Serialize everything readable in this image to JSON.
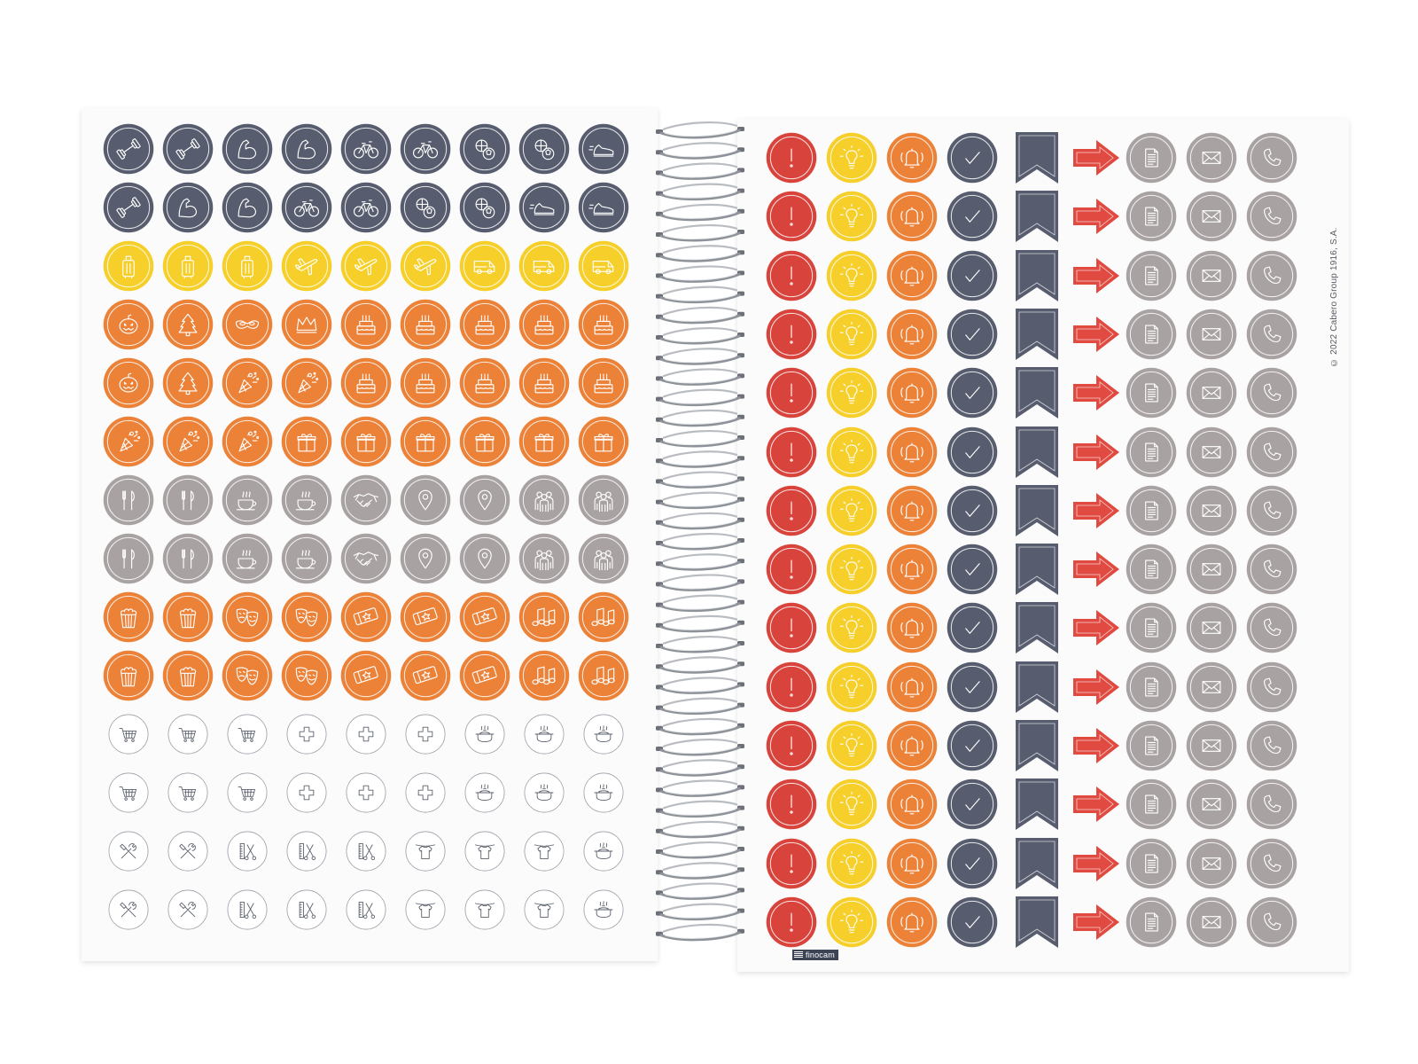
{
  "colors": {
    "slate": "#575d6e",
    "yellow": "#f6cf2b",
    "orange": "#ec8138",
    "gray": "#a9a2a2",
    "red": "#d8433c",
    "arrow_red": "#e04a40",
    "outline": "#8b9099",
    "page": "#fbfbfb",
    "wire": "#8e939a"
  },
  "left_sheet": {
    "rows": [
      {
        "color": "slate",
        "icons": [
          "dumbbell-icon",
          "dumbbell-icon",
          "flexed-arm-icon",
          "flexed-arm-icon",
          "bicycle-icon",
          "bicycle-icon",
          "sports-balls-icon",
          "sports-balls-icon",
          "sneaker-icon"
        ]
      },
      {
        "color": "slate",
        "icons": [
          "dumbbell-icon",
          "flexed-arm-icon",
          "flexed-arm-icon",
          "bicycle-icon",
          "bicycle-icon",
          "sports-balls-icon",
          "sports-balls-icon",
          "sneaker-icon",
          "sneaker-icon"
        ]
      },
      {
        "color": "yellow",
        "icons": [
          "suitcase-icon",
          "suitcase-icon",
          "suitcase-icon",
          "airplane-icon",
          "airplane-icon",
          "airplane-icon",
          "van-icon",
          "van-icon",
          "van-icon"
        ]
      },
      {
        "color": "orange",
        "icons": [
          "pumpkin-icon",
          "christmas-tree-icon",
          "carnival-mask-icon",
          "crown-icon",
          "birthday-cake-icon",
          "birthday-cake-icon",
          "birthday-cake-icon",
          "birthday-cake-icon",
          "birthday-cake-icon"
        ]
      },
      {
        "color": "orange",
        "icons": [
          "pumpkin-icon",
          "christmas-tree-icon",
          "party-popper-icon",
          "party-popper-icon",
          "birthday-cake-icon",
          "birthday-cake-icon",
          "birthday-cake-icon",
          "birthday-cake-icon",
          "birthday-cake-icon"
        ]
      },
      {
        "color": "orange",
        "icons": [
          "party-popper-icon",
          "party-popper-icon",
          "party-popper-icon",
          "gift-icon",
          "gift-icon",
          "gift-icon",
          "gift-icon",
          "gift-icon",
          "gift-icon"
        ]
      },
      {
        "color": "gray",
        "icons": [
          "cutlery-icon",
          "cutlery-icon",
          "coffee-cup-icon",
          "coffee-cup-icon",
          "handshake-icon",
          "map-pin-icon",
          "map-pin-icon",
          "group-icon",
          "group-icon"
        ]
      },
      {
        "color": "gray",
        "icons": [
          "cutlery-icon",
          "cutlery-icon",
          "coffee-cup-icon",
          "coffee-cup-icon",
          "handshake-icon",
          "map-pin-icon",
          "map-pin-icon",
          "group-icon",
          "group-icon"
        ]
      },
      {
        "color": "orange",
        "icons": [
          "popcorn-icon",
          "popcorn-icon",
          "theater-masks-icon",
          "theater-masks-icon",
          "tickets-icon",
          "tickets-icon",
          "tickets-icon",
          "music-notes-icon",
          "music-notes-icon"
        ]
      },
      {
        "color": "orange",
        "icons": [
          "popcorn-icon",
          "popcorn-icon",
          "theater-masks-icon",
          "theater-masks-icon",
          "tickets-icon",
          "tickets-icon",
          "tickets-icon",
          "music-notes-icon",
          "music-notes-icon"
        ]
      },
      {
        "color": "outline",
        "icons": [
          "shopping-cart-icon",
          "shopping-cart-icon",
          "shopping-cart-icon",
          "medical-cross-icon",
          "medical-cross-icon",
          "medical-cross-icon",
          "cooking-pot-icon",
          "cooking-pot-icon",
          "cooking-pot-icon"
        ]
      },
      {
        "color": "outline",
        "icons": [
          "shopping-cart-icon",
          "shopping-cart-icon",
          "shopping-cart-icon",
          "medical-cross-icon",
          "medical-cross-icon",
          "medical-cross-icon",
          "cooking-pot-icon",
          "cooking-pot-icon",
          "cooking-pot-icon"
        ]
      },
      {
        "color": "outline",
        "icons": [
          "tools-icon",
          "tools-icon",
          "comb-scissors-icon",
          "comb-scissors-icon",
          "comb-scissors-icon",
          "laundry-shirt-icon",
          "laundry-shirt-icon",
          "laundry-shirt-icon",
          "cooking-pot-icon"
        ]
      },
      {
        "color": "outline",
        "icons": [
          "tools-icon",
          "tools-icon",
          "comb-scissors-icon",
          "comb-scissors-icon",
          "comb-scissors-icon",
          "laundry-shirt-icon",
          "laundry-shirt-icon",
          "laundry-shirt-icon",
          "cooking-pot-icon"
        ]
      }
    ]
  },
  "right_sheet": {
    "row_count": 14,
    "columns": [
      {
        "icon": "exclamation-icon",
        "color": "red",
        "shape": "circle"
      },
      {
        "icon": "lightbulb-icon",
        "color": "yellow",
        "shape": "circle"
      },
      {
        "icon": "bell-icon",
        "color": "orange",
        "shape": "circle"
      },
      {
        "icon": "checkmark-icon",
        "color": "slate",
        "shape": "circle"
      },
      {
        "icon": "bookmark-icon",
        "color": "slate",
        "shape": "bookmark"
      },
      {
        "icon": "arrow-right-icon",
        "color": "arrow_red",
        "shape": "arrow"
      },
      {
        "icon": "document-icon",
        "color": "gray",
        "shape": "circle"
      },
      {
        "icon": "envelope-icon",
        "color": "gray",
        "shape": "circle"
      },
      {
        "icon": "phone-icon",
        "color": "gray",
        "shape": "circle"
      }
    ]
  },
  "brand": "finocam",
  "copyright": "© 2022 Cabero Group 1916, S.A."
}
